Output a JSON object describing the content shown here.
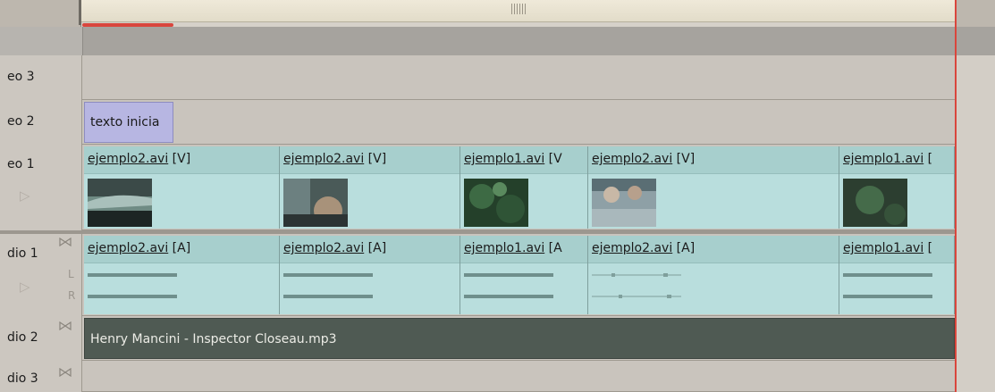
{
  "timeline": {
    "tracks": {
      "video3": {
        "label": "eo 3"
      },
      "video2": {
        "label": "eo 2"
      },
      "video1": {
        "label": "eo 1"
      },
      "audio1": {
        "label": "dio 1",
        "left_channel": "L",
        "right_channel": "R"
      },
      "audio2": {
        "label": "dio 2"
      },
      "audio3": {
        "label": "dio 3"
      }
    },
    "title_clip": {
      "name": "texto inicia"
    },
    "video_clips": [
      {
        "file": "ejemplo2.avi",
        "tag": "[V]"
      },
      {
        "file": "ejemplo2.avi",
        "tag": "[V]"
      },
      {
        "file": "ejemplo1.avi",
        "tag": "[V"
      },
      {
        "file": "ejemplo2.avi",
        "tag": "[V]"
      },
      {
        "file": "ejemplo1.avi",
        "tag": "["
      }
    ],
    "audio_clips": [
      {
        "file": "ejemplo2.avi",
        "tag": "[A]"
      },
      {
        "file": "ejemplo2.avi",
        "tag": "[A]"
      },
      {
        "file": "ejemplo1.avi",
        "tag": "[A"
      },
      {
        "file": "ejemplo2.avi",
        "tag": "[A]"
      },
      {
        "file": "ejemplo1.avi",
        "tag": "["
      }
    ],
    "music_clip": {
      "name": "Henry Mancini - Inspector Closeau.mp3"
    }
  },
  "icons": {
    "track_toggle": "play-triangle-icon",
    "sync_lock": "sync-lock-icon"
  },
  "colors": {
    "clip_fill": "#b9dedd",
    "clip_header": "#a7cfcd",
    "title_clip": "#b7b6e2",
    "music_clip": "#4f5a53",
    "end_marker": "#d9463d"
  }
}
